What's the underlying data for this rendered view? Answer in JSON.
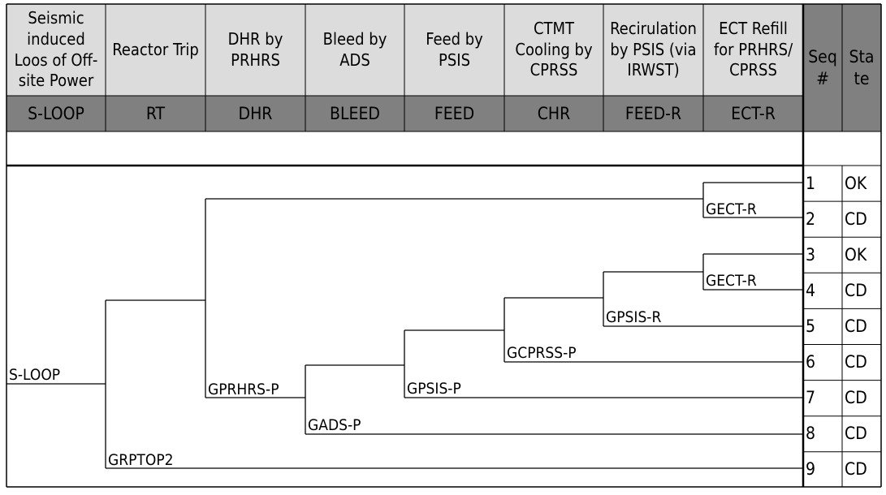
{
  "header": {
    "columns": [
      {
        "title": "Seismic induced Loos of Off-site Power",
        "code": "S-LOOP"
      },
      {
        "title": "Reactor Trip",
        "code": "RT"
      },
      {
        "title": "DHR by PRHRS",
        "code": "DHR"
      },
      {
        "title": "Bleed by ADS",
        "code": "BLEED"
      },
      {
        "title": "Feed by PSIS",
        "code": "FEED"
      },
      {
        "title": "CTMT Cooling by CPRSS",
        "code": "CHR"
      },
      {
        "title": "Recirulation by PSIS (via IRWST)",
        "code": "FEED-R"
      },
      {
        "title": "ECT Refill for PRHRS/ CPRSS",
        "code": "ECT-R"
      }
    ],
    "seq_label": "Seq #",
    "state_label": "State"
  },
  "tree": {
    "initiator": "S-LOOP",
    "gates": [
      "GRPTOP2",
      "GPRHRS-P",
      "GADS-P",
      "GPSIS-P",
      "GCPRSS-P",
      "GPSIS-R",
      "GECT-R",
      "GECT-R"
    ]
  },
  "sequences": [
    {
      "seq": "1",
      "state": "OK"
    },
    {
      "seq": "2",
      "state": "CD"
    },
    {
      "seq": "3",
      "state": "OK"
    },
    {
      "seq": "4",
      "state": "CD"
    },
    {
      "seq": "5",
      "state": "CD"
    },
    {
      "seq": "6",
      "state": "CD"
    },
    {
      "seq": "7",
      "state": "CD"
    },
    {
      "seq": "8",
      "state": "CD"
    },
    {
      "seq": "9",
      "state": "CD"
    }
  ]
}
